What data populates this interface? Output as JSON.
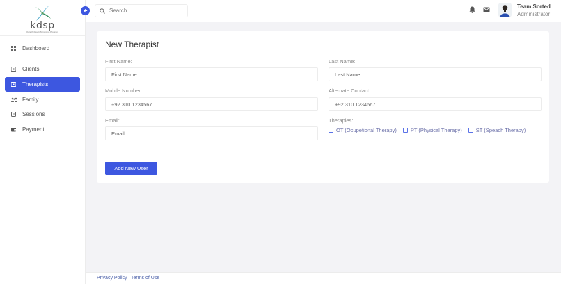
{
  "brand": {
    "logo_text": "kdsp",
    "logo_sub": "Karachi Down Syndrome Program"
  },
  "sidebar": {
    "items": [
      {
        "label": "Dashboard",
        "icon": "grid-icon",
        "active": false
      },
      {
        "label": "Clients",
        "icon": "clients-icon",
        "active": false
      },
      {
        "label": "Therapists",
        "icon": "therapist-icon",
        "active": true
      },
      {
        "label": "Family",
        "icon": "family-icon",
        "active": false
      },
      {
        "label": "Sessions",
        "icon": "sessions-icon",
        "active": false
      },
      {
        "label": "Payment",
        "icon": "payment-icon",
        "active": false
      }
    ]
  },
  "topbar": {
    "search_placeholder": "Search...",
    "user_name": "Team Sorted",
    "user_role": "Administrator"
  },
  "form": {
    "title": "New Therapist",
    "first_name": {
      "label": "First Name:",
      "placeholder": "First Name",
      "value": ""
    },
    "last_name": {
      "label": "Last Name:",
      "placeholder": "Last Name",
      "value": ""
    },
    "mobile": {
      "label": "Mobile Number:",
      "placeholder": "+92 310 1234567",
      "value": ""
    },
    "alternate": {
      "label": "Alternate Contact:",
      "placeholder": "+92 310 1234567",
      "value": ""
    },
    "email": {
      "label": "Email:",
      "placeholder": "Email",
      "value": ""
    },
    "therapies": {
      "label": "Therapies:",
      "options": [
        {
          "label": "OT (Ocupetional Therapy)",
          "checked": false
        },
        {
          "label": "PT (Physical Therapy)",
          "checked": false
        },
        {
          "label": "ST (Speach Therapy)",
          "checked": false
        }
      ]
    },
    "submit_label": "Add New User"
  },
  "footer": {
    "privacy": "Privacy Policy",
    "terms": "Terms of Use"
  },
  "colors": {
    "accent": "#3d57e0",
    "background": "#f3f3f6"
  }
}
